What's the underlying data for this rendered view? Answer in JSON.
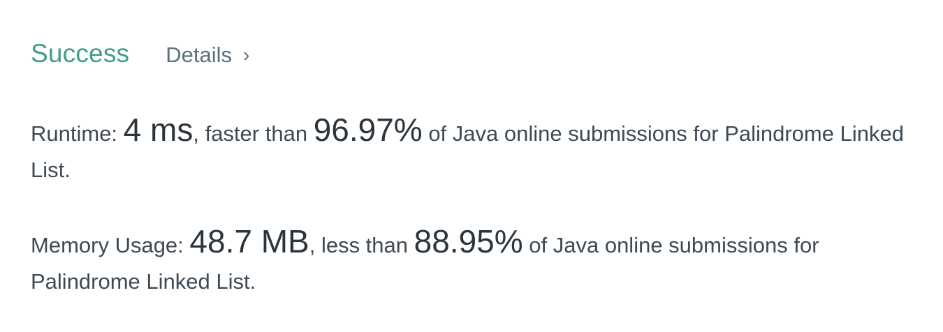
{
  "result": {
    "status": "Success",
    "details_label": "Details",
    "details_chevron": "›"
  },
  "runtime": {
    "label": "Runtime: ",
    "value": "4 ms",
    "comparison": ", faster than ",
    "percentile": "96.97%",
    "suffix": " of Java online submissions for Palindrome Linked List."
  },
  "memory": {
    "label": "Memory Usage: ",
    "value": "48.7 MB",
    "comparison": ", less than ",
    "percentile": "88.95%",
    "suffix": " of Java online submissions for Palindrome Linked List."
  },
  "colors": {
    "success": "#3d9e8a",
    "link": "#5c6f7c",
    "text": "#3c4a55"
  },
  "icons": {
    "details": "chevron-right-icon"
  }
}
